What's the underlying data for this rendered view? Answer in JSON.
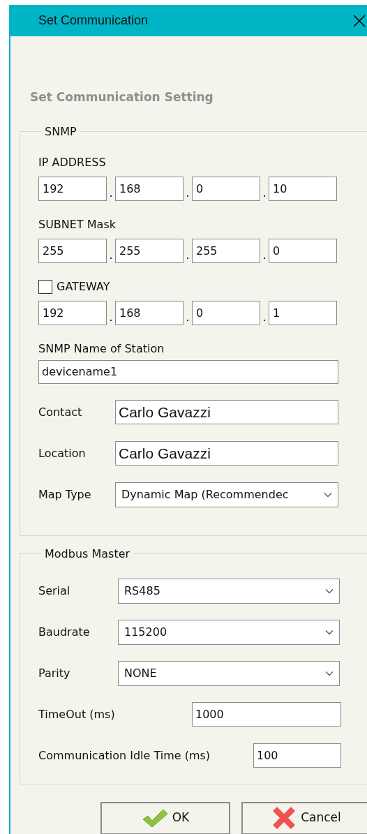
{
  "window": {
    "title": "Set Communication"
  },
  "heading": "Set Communication Setting",
  "snmp": {
    "legend": "SNMP",
    "ip_groups": [
      {
        "kind": "plain",
        "label": "IP ADDRESS",
        "separator": ".",
        "octets": [
          "192",
          "168",
          "0",
          "10"
        ]
      },
      {
        "kind": "plain",
        "label": "SUBNET Mask",
        "separator": ".",
        "octets": [
          "255",
          "255",
          "255",
          "0"
        ]
      },
      {
        "kind": "checkbox",
        "label": "GATEWAY",
        "checked": false,
        "separator": ".",
        "octets": [
          "192",
          "168",
          "0",
          "1"
        ]
      }
    ],
    "station": {
      "label": "SNMP Name of Station",
      "value": "devicename1"
    },
    "rows": [
      {
        "kind": "input",
        "label": "Contact",
        "value": "Carlo Gavazzi"
      },
      {
        "kind": "input",
        "label": "Location",
        "value": "Carlo Gavazzi"
      },
      {
        "kind": "select",
        "label": "Map Type",
        "value": "Dynamic Map (Recommendec"
      }
    ]
  },
  "modbus": {
    "legend": "Modbus Master",
    "rows": [
      {
        "kind": "select",
        "label": "Serial",
        "value": "RS485"
      },
      {
        "kind": "select",
        "label": "Baudrate",
        "value": "115200"
      },
      {
        "kind": "select",
        "label": "Parity",
        "value": "NONE"
      },
      {
        "kind": "input",
        "label": "TimeOut (ms)",
        "value": "1000"
      },
      {
        "kind": "input",
        "label": "Communication Idle Time (ms)",
        "value": "100"
      }
    ]
  },
  "buttons": [
    {
      "kind": "ok",
      "label": "OK"
    },
    {
      "kind": "cancel",
      "label": "Cancel"
    }
  ]
}
